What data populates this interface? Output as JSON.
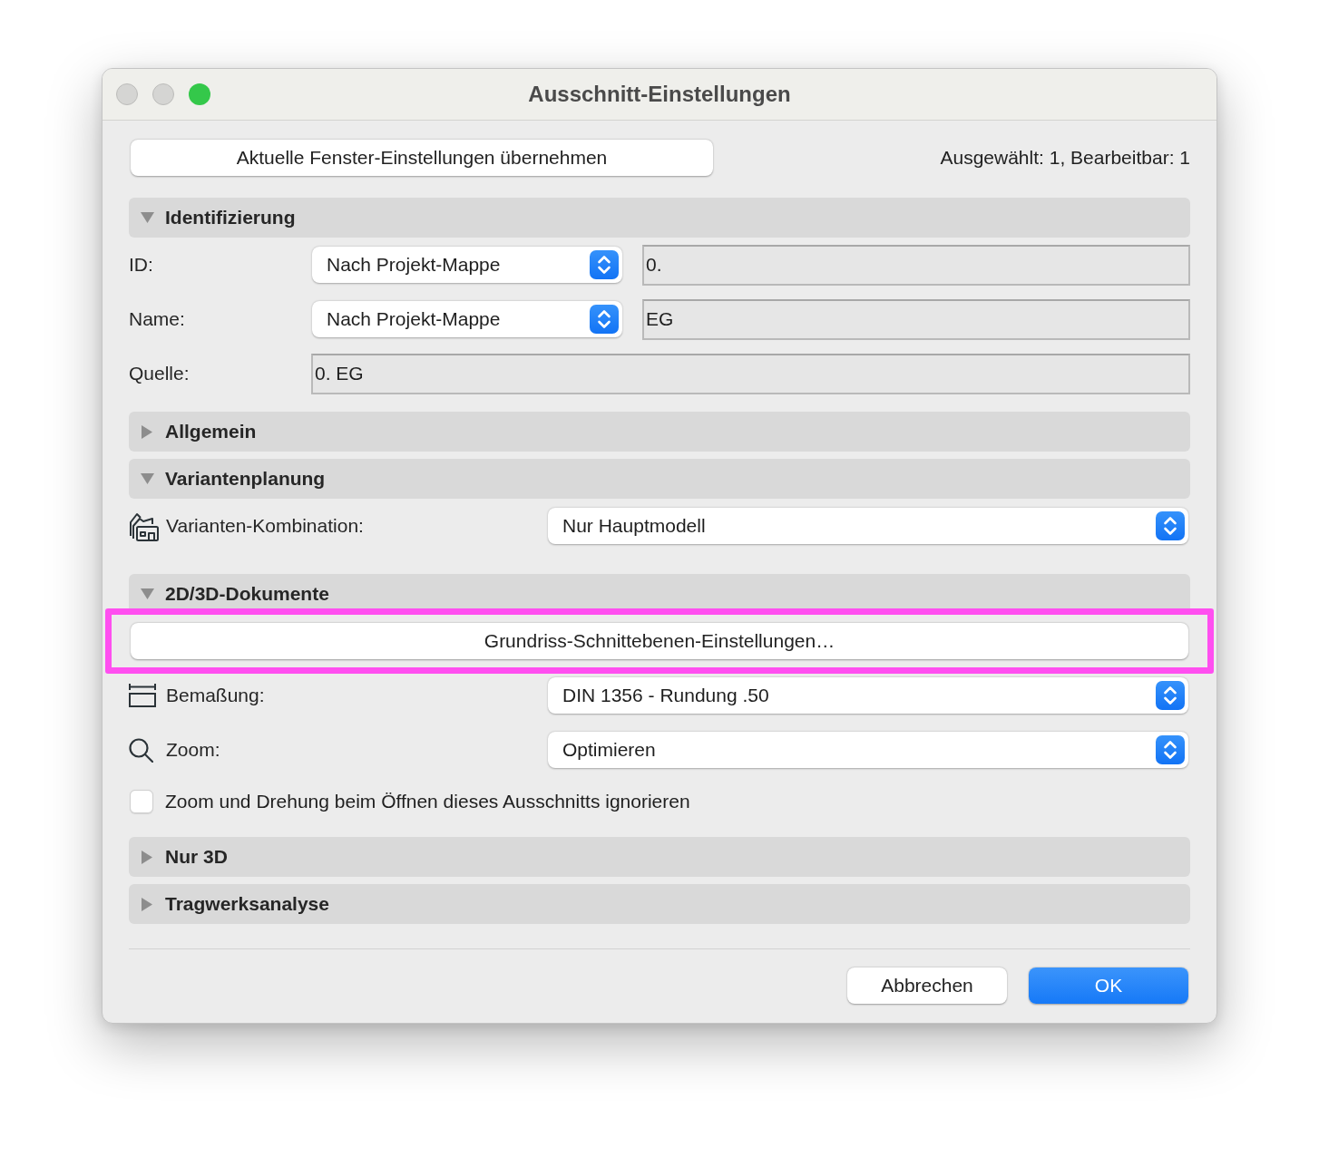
{
  "window": {
    "title": "Ausschnitt-Einstellungen",
    "traffic_lights": [
      {
        "kind": "close",
        "disabled": true
      },
      {
        "kind": "minimize",
        "disabled": true
      },
      {
        "kind": "zoom",
        "disabled": false
      }
    ]
  },
  "toolbar": {
    "button": "Aktuelle Fenster-Einstellungen übernehmen",
    "selection_info": "Ausgewählt: 1, Bearbeitbar: 1"
  },
  "sections": [
    {
      "title": "Identifizierung",
      "expanded": true,
      "rows": [
        {
          "kind": "popup_field",
          "label": "ID:",
          "popup": "Nach Projekt-Mappe",
          "value": "0."
        },
        {
          "kind": "popup_field",
          "label": "Name:",
          "popup": "Nach Projekt-Mappe",
          "value": "EG"
        },
        {
          "kind": "field",
          "label": "Quelle:",
          "value": "0. EG"
        }
      ]
    },
    {
      "title": "Allgemein",
      "expanded": false
    },
    {
      "title": "Variantenplanung",
      "expanded": true,
      "rows": [
        {
          "kind": "variant_select",
          "label": "Varianten-Kombination:",
          "popup": "Nur Hauptmodell"
        }
      ]
    },
    {
      "title": "2D/3D-Dokumente",
      "expanded": true,
      "rows": [
        {
          "kind": "button",
          "label": "Grundriss-Schnittebenen-Einstellungen…",
          "highlighted": true
        },
        {
          "kind": "dimension_select",
          "label": "Bemaßung:",
          "popup": "DIN 1356 - Rundung .50"
        },
        {
          "kind": "zoom_select",
          "label": "Zoom:",
          "popup": "Optimieren"
        },
        {
          "kind": "checkbox",
          "label": "Zoom und Drehung beim Öffnen dieses Ausschnitts ignorieren",
          "checked": false
        }
      ]
    },
    {
      "title": "Nur 3D",
      "expanded": false
    },
    {
      "title": "Tragwerksanalyse",
      "expanded": false
    }
  ],
  "buttons": [
    {
      "label": "Abbrechen",
      "default": false
    },
    {
      "label": "OK",
      "default": true
    }
  ]
}
